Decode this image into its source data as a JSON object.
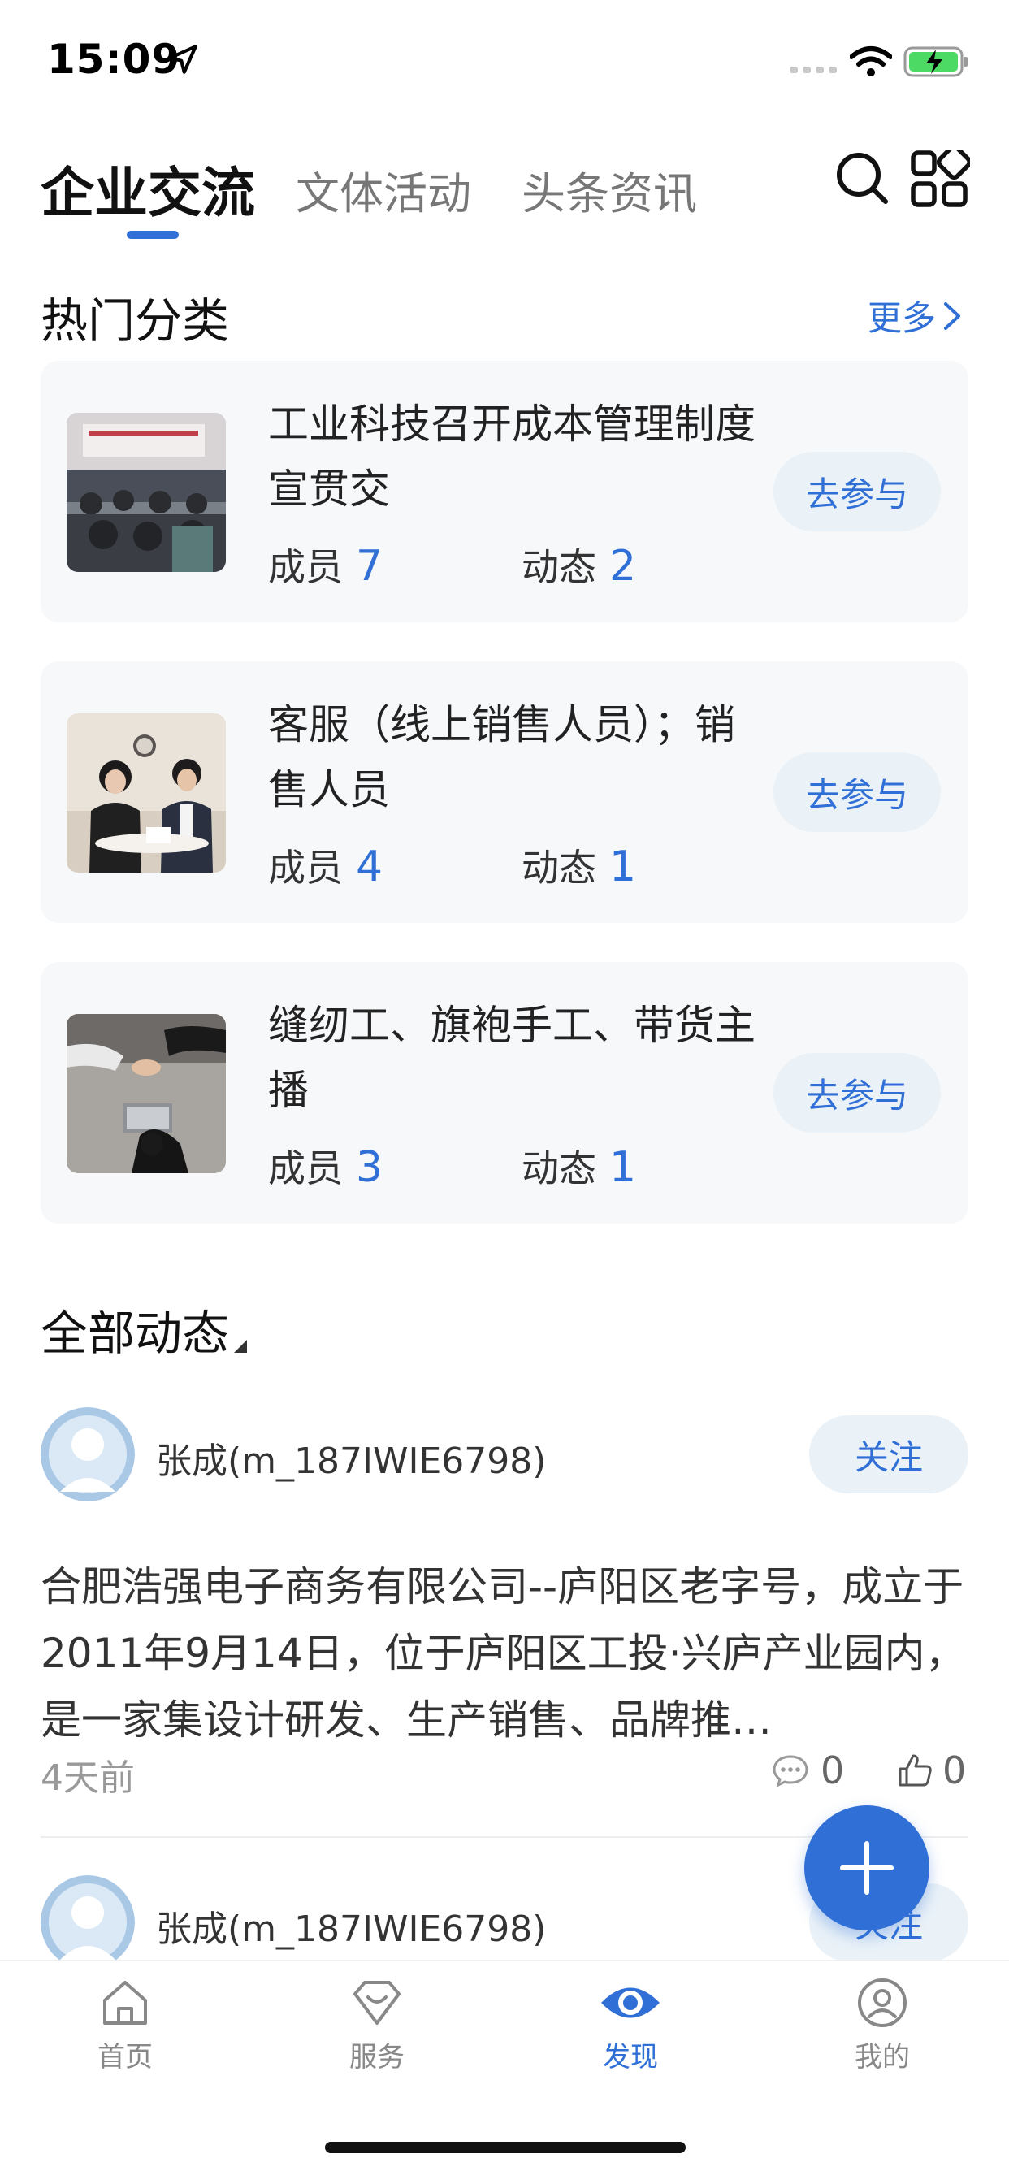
{
  "status_bar": {
    "time": "15:09"
  },
  "top_tabs": [
    {
      "label": "企业交流",
      "active": true
    },
    {
      "label": "文体活动",
      "active": false
    },
    {
      "label": "头条资讯",
      "active": false
    }
  ],
  "hot_section": {
    "title": "热门分类",
    "more": "更多"
  },
  "categories": [
    {
      "title": "工业科技召开成本管理制度宣贯交",
      "members_label": "成员",
      "members": "7",
      "posts_label": "动态",
      "posts": "2",
      "join": "去参与"
    },
    {
      "title": "客服（线上销售人员）；销售人员",
      "members_label": "成员",
      "members": "4",
      "posts_label": "动态",
      "posts": "1",
      "join": "去参与"
    },
    {
      "title": "缝纫工、旗袍手工、带货主播",
      "members_label": "成员",
      "members": "3",
      "posts_label": "动态",
      "posts": "1",
      "join": "去参与"
    }
  ],
  "feed": {
    "title": "全部动态",
    "posts": [
      {
        "username": "张成(m_187IWIE6798)",
        "follow": "关注",
        "text": "合肥浩强电子商务有限公司--庐阳区老字号，成立于2011年9月14日，位于庐阳区工投·兴庐产业园内，是一家集设计研发、生产销售、品牌推…",
        "time": "4天前",
        "comments": "0",
        "likes": "0"
      },
      {
        "username": "张成(m_187IWIE6798)",
        "follow": "关注"
      }
    ]
  },
  "bottom_nav": [
    {
      "label": "首页",
      "icon": "home-icon",
      "active": false
    },
    {
      "label": "服务",
      "icon": "diamond-icon",
      "active": false
    },
    {
      "label": "发现",
      "icon": "eye-icon",
      "active": true
    },
    {
      "label": "我的",
      "icon": "profile-icon",
      "active": false
    }
  ],
  "colors": {
    "accent": "#2f6fd6",
    "button_bg": "#eaf2f8",
    "card_bg": "#f7f8fa"
  }
}
